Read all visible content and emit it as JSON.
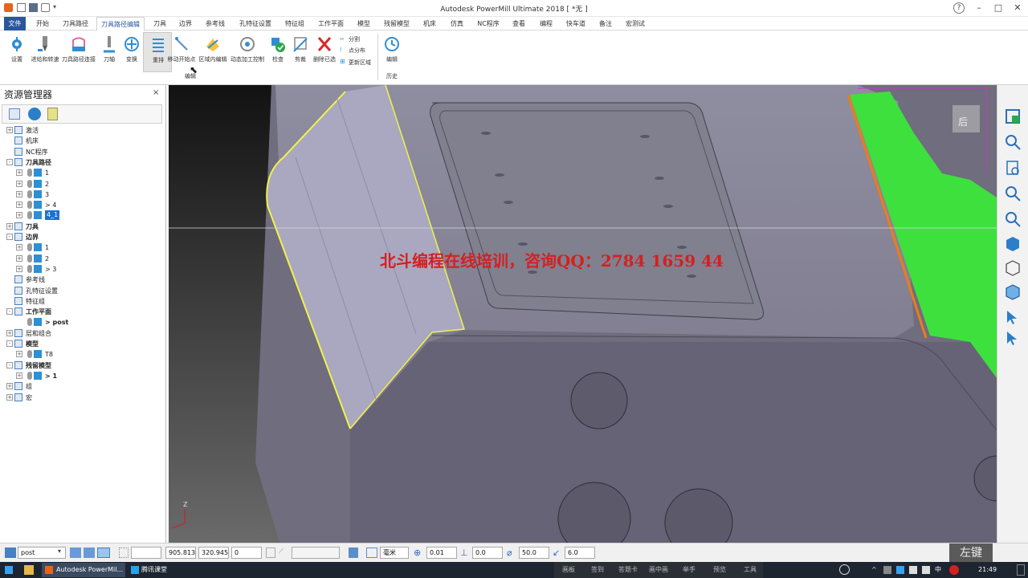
{
  "app": {
    "title": "Autodesk PowerMill Ultimate 2018 [ *无 ]"
  },
  "tabs": [
    "文件",
    "开始",
    "刀具路径",
    "刀具路径编辑",
    "刀具",
    "边界",
    "参考线",
    "孔特征设置",
    "特征组",
    "工作平面",
    "模型",
    "残留模型",
    "机床",
    "仿真",
    "NC程序",
    "查看",
    "编程",
    "快车道",
    "备注",
    "宏测试"
  ],
  "active_tab": "刀具路径编辑",
  "ribbon": {
    "buttons": [
      {
        "label": "设置",
        "icon": "settings-icon"
      },
      {
        "label": "进给和转速",
        "icon": "feed-speed-icon"
      },
      {
        "label": "刀具路径连接",
        "icon": "toolpath-link-icon"
      },
      {
        "label": "刀轴",
        "icon": "tool-axis-icon"
      },
      {
        "label": "变换",
        "icon": "transform-icon"
      },
      {
        "label": "重排",
        "icon": "reorder-icon"
      },
      {
        "label": "移动开始点",
        "icon": "move-start-icon"
      },
      {
        "label": "区域内编辑",
        "icon": "region-edit-icon"
      },
      {
        "label": "动态加工控制",
        "icon": "dynamic-control-icon"
      },
      {
        "label": "检查",
        "icon": "check-icon"
      },
      {
        "label": "剪裁",
        "icon": "trim-icon"
      },
      {
        "label": "删除已选",
        "icon": "delete-selected-icon"
      }
    ],
    "small_buttons": [
      "分割",
      "点分布",
      "更新区域"
    ],
    "group_edit": "编辑",
    "history_button": "编辑",
    "group_history": "历史"
  },
  "explorer": {
    "title": "资源管理器",
    "tree": [
      {
        "label": "激活",
        "level": 0,
        "exp": "+"
      },
      {
        "label": "机床",
        "level": 0,
        "exp": ""
      },
      {
        "label": "NC程序",
        "level": 0,
        "exp": ""
      },
      {
        "label": "刀具路径",
        "level": 0,
        "exp": "-",
        "bold": true
      },
      {
        "label": "1",
        "level": 1,
        "exp": "+"
      },
      {
        "label": "2",
        "level": 1,
        "exp": "+"
      },
      {
        "label": "3",
        "level": 1,
        "exp": "+"
      },
      {
        "label": "> 4",
        "level": 1,
        "exp": "+"
      },
      {
        "label": "4_1",
        "level": 1,
        "exp": "+",
        "selected": true
      },
      {
        "label": "刀具",
        "level": 0,
        "exp": "+",
        "bold": true
      },
      {
        "label": "边界",
        "level": 0,
        "exp": "-",
        "bold": true
      },
      {
        "label": "1",
        "level": 1,
        "exp": "+"
      },
      {
        "label": "2",
        "level": 1,
        "exp": "+"
      },
      {
        "label": "> 3",
        "level": 1,
        "exp": "+"
      },
      {
        "label": "参考线",
        "level": 0,
        "exp": ""
      },
      {
        "label": "孔特征设置",
        "level": 0,
        "exp": ""
      },
      {
        "label": "特征组",
        "level": 0,
        "exp": ""
      },
      {
        "label": "工作平面",
        "level": 0,
        "exp": "-",
        "bold": true
      },
      {
        "label": "> post",
        "level": 1,
        "exp": "",
        "bold": true
      },
      {
        "label": "层和组合",
        "level": 0,
        "exp": "+"
      },
      {
        "label": "模型",
        "level": 0,
        "exp": "-",
        "bold": true
      },
      {
        "label": "T8",
        "level": 1,
        "exp": "+"
      },
      {
        "label": "残留模型",
        "level": 0,
        "exp": "-",
        "bold": true
      },
      {
        "label": "> 1",
        "level": 1,
        "exp": "+",
        "bold": true
      },
      {
        "label": "组",
        "level": 0,
        "exp": "+"
      },
      {
        "label": "宏",
        "level": 0,
        "exp": "+"
      }
    ]
  },
  "viewport": {
    "watermark": "北斗编程在线培训，咨询QQ：2784 1659 44",
    "viewcube_label": "后",
    "axis_label": "Z",
    "overlay_key": "左键"
  },
  "statusbar": {
    "workplane": "post",
    "x": "905.813",
    "y": "320.945",
    "z": "0",
    "units": "毫米",
    "tol": "0.01",
    "thickness": "0.0",
    "diameter": "50.0",
    "step": "6.0"
  },
  "taskbar": {
    "items": [
      "Autodesk PowerMil...",
      "腾讯课堂"
    ],
    "right_labels": [
      "画板",
      "签到",
      "答题卡",
      "画中画",
      "举手",
      "预览",
      "工具"
    ],
    "lang": "中",
    "time": "21:49"
  },
  "colors": {
    "file_tab": "#2b579a",
    "model_face": "#7d7b8c",
    "highlight": "#f2f24a",
    "green_surface": "#3ee03e",
    "watermark": "#d42020"
  }
}
